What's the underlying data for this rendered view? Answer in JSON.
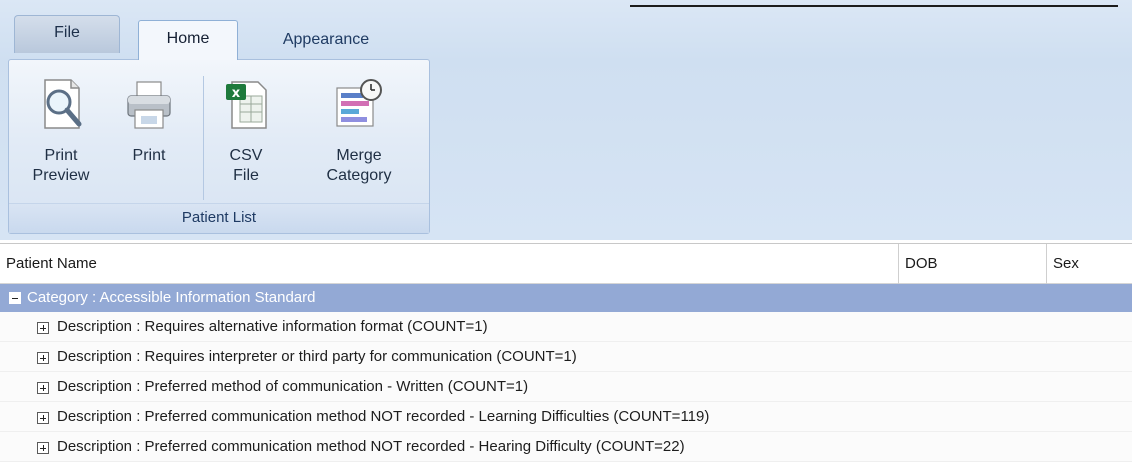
{
  "ribbon": {
    "tabs": [
      {
        "label": "File"
      },
      {
        "label": "Home"
      },
      {
        "label": "Appearance"
      }
    ],
    "group": {
      "label": "Patient List",
      "buttons": [
        {
          "line1": "Print",
          "line2": "Preview",
          "icon": "print-preview-icon"
        },
        {
          "line1": "Print",
          "line2": "",
          "icon": "printer-icon"
        },
        {
          "line1": "CSV",
          "line2": "File",
          "icon": "csv-file-icon"
        },
        {
          "line1": "Merge",
          "line2": "Category",
          "icon": "merge-category-icon"
        }
      ]
    }
  },
  "grid": {
    "columns": [
      "Patient Name",
      "DOB",
      "Sex"
    ],
    "category": "Category : Accessible Information Standard",
    "rows": [
      "Description : Requires alternative information format (COUNT=1)",
      "Description : Requires interpreter or third party for communication (COUNT=1)",
      "Description : Preferred method of communication - Written (COUNT=1)",
      "Description : Preferred communication method NOT recorded - Learning Difficulties (COUNT=119)",
      "Description : Preferred communication method NOT recorded - Hearing Difficulty (COUNT=22)"
    ]
  }
}
